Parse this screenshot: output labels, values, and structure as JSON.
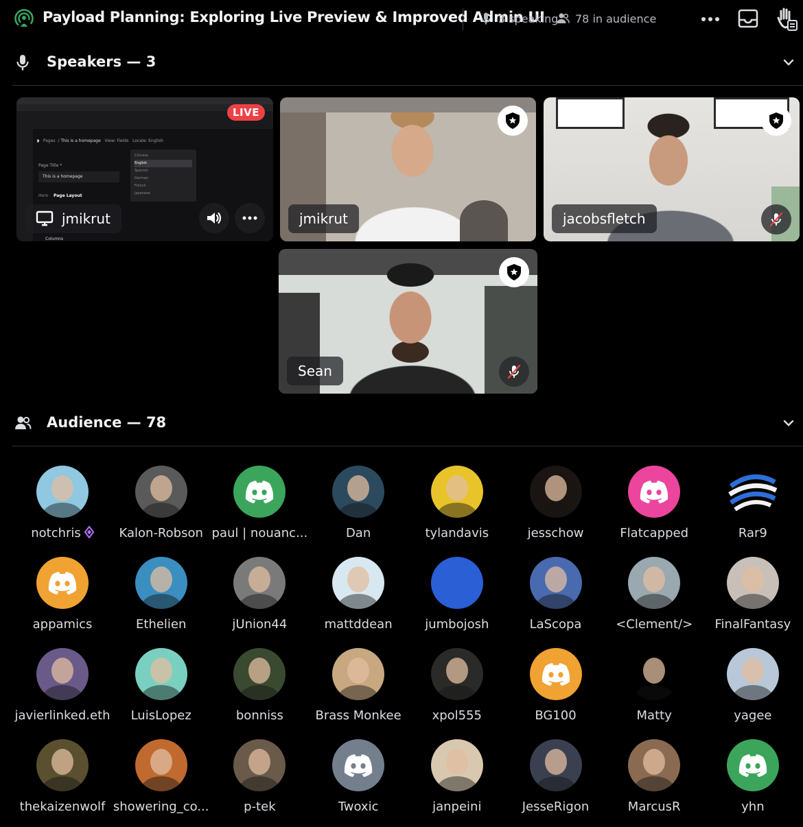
{
  "header": {
    "title": "Payload Planning: Exploring Live Preview & Improved Admin UI",
    "speaking": "3 speaking",
    "audience_count": "78 in audience",
    "accent": "#3ba55c"
  },
  "speakers_section": {
    "title": "Speakers — 3"
  },
  "audience_section": {
    "title": "Audience — 78"
  },
  "tiles": {
    "screen": {
      "name": "jmikrut",
      "live_label": "LIVE",
      "screen_text": {
        "breadcrumb_pages": "Pages",
        "breadcrumb_title": "This is a homepage",
        "view": "View: Fields",
        "locale": "Locale: English",
        "page_title_label": "Page Title *",
        "page_title_value": "This is a homepage",
        "tab_hero": "Hero",
        "tab_layout": "Page Layout",
        "columns": "Columns",
        "locales": [
          "Chinese",
          "English",
          "Spanish",
          "German",
          "French",
          "Japanese"
        ]
      }
    },
    "cam1": {
      "name": "jmikrut"
    },
    "cam2": {
      "name": "jacobsfletch"
    },
    "cam3": {
      "name": "Sean"
    }
  },
  "audience": [
    {
      "name": "notchris",
      "color": "#8fc8e0",
      "kind": "photo"
    },
    {
      "name": "Kalon-Robson",
      "color": "#5a5a5a",
      "kind": "photo"
    },
    {
      "name": "paul | nouanc...",
      "color": "#3ba55c",
      "kind": "discord"
    },
    {
      "name": "Dan",
      "color": "#2c4a5e",
      "kind": "photo"
    },
    {
      "name": "tylandavis",
      "color": "#e8c42a",
      "kind": "photo"
    },
    {
      "name": "jesschow",
      "color": "#1a1412",
      "kind": "photo"
    },
    {
      "name": "Flatcapped",
      "color": "#eb459e",
      "kind": "discord"
    },
    {
      "name": "Rar9",
      "color": "#000000",
      "kind": "rar"
    },
    {
      "name": "appamics",
      "color": "#f0a232",
      "kind": "discord"
    },
    {
      "name": "Ethelien",
      "color": "#3a8fc0",
      "kind": "photo"
    },
    {
      "name": "jUnion44",
      "color": "#7a7a7a",
      "kind": "photo"
    },
    {
      "name": "mattddean",
      "color": "#d8e8f0",
      "kind": "photo"
    },
    {
      "name": "jumbojosh",
      "color": "#2a5fd6",
      "kind": "solid"
    },
    {
      "name": "LaScopa",
      "color": "#4a6ab0",
      "kind": "photo"
    },
    {
      "name": "<Clement/>",
      "color": "#9aa8b0",
      "kind": "photo"
    },
    {
      "name": "FinalFantasy",
      "color": "#c8c0b8",
      "kind": "photo"
    },
    {
      "name": "javierlinked.eth",
      "color": "#6a5a8a",
      "kind": "photo"
    },
    {
      "name": "LuisLopez",
      "color": "#7ad0c0",
      "kind": "photo"
    },
    {
      "name": "bonniss",
      "color": "#3a4a30",
      "kind": "photo"
    },
    {
      "name": "Brass Monkee",
      "color": "#c8a880",
      "kind": "photo"
    },
    {
      "name": "xpol555",
      "color": "#2a2a28",
      "kind": "photo"
    },
    {
      "name": "BG100",
      "color": "#f0a232",
      "kind": "discord"
    },
    {
      "name": "Matty",
      "color": "#000000",
      "kind": "photo"
    },
    {
      "name": "yagee",
      "color": "#b8c8d8",
      "kind": "photo"
    },
    {
      "name": "thekaizenwolf",
      "color": "#5a5030",
      "kind": "photo"
    },
    {
      "name": "showering_co...",
      "color": "#c06a30",
      "kind": "photo"
    },
    {
      "name": "p-tek",
      "color": "#6a5a4a",
      "kind": "photo"
    },
    {
      "name": "Twoxic",
      "color": "#747f8d",
      "kind": "discord"
    },
    {
      "name": "janpeini",
      "color": "#d8c8b0",
      "kind": "photo"
    },
    {
      "name": "JesseRigon",
      "color": "#3a4050",
      "kind": "photo"
    },
    {
      "name": "MarcusR",
      "color": "#8a6a50",
      "kind": "photo"
    },
    {
      "name": "yhn",
      "color": "#3ba55c",
      "kind": "discord"
    }
  ]
}
